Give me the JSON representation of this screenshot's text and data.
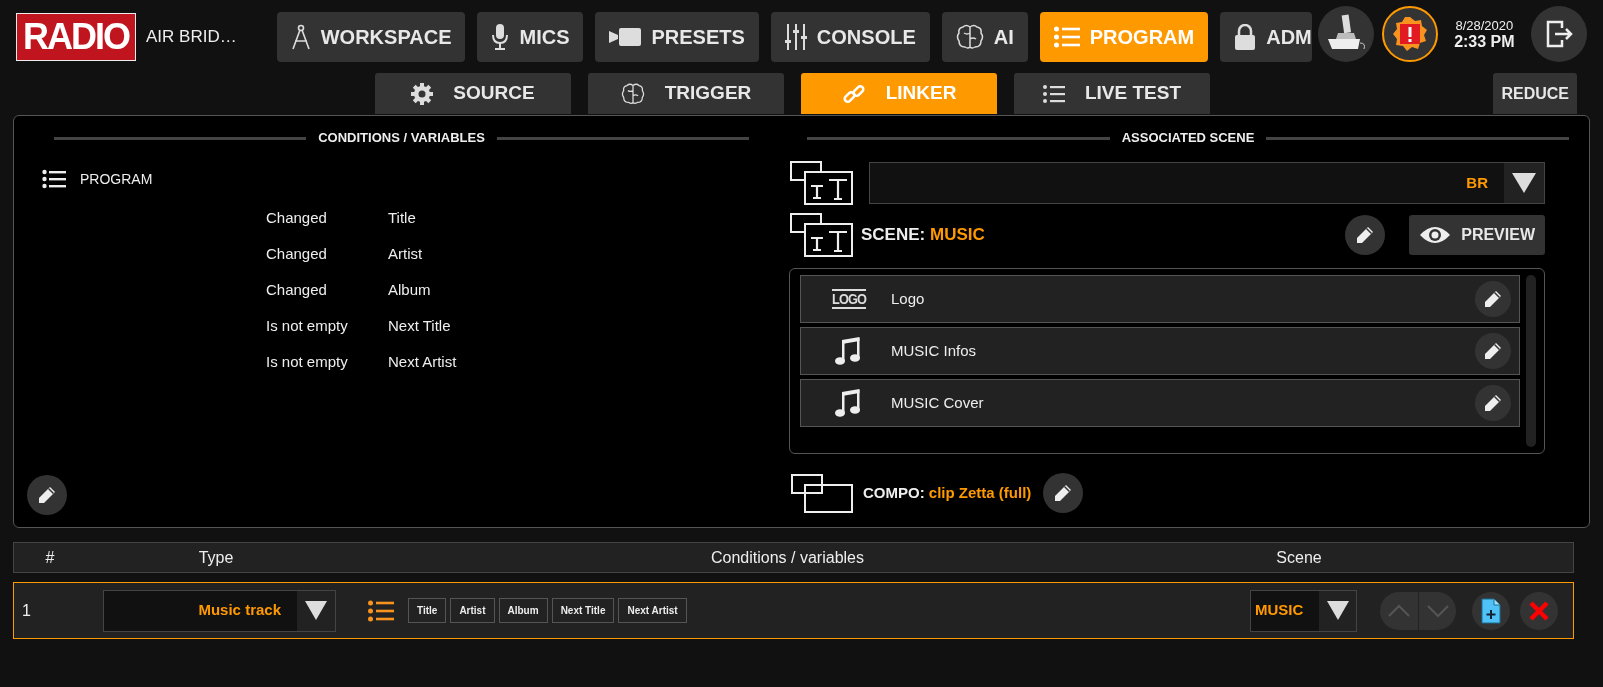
{
  "header": {
    "logo": "RADIO",
    "station": "AIR BRID…",
    "nav": [
      {
        "label": "WORKSPACE",
        "selected": false
      },
      {
        "label": "MICS",
        "selected": false
      },
      {
        "label": "PRESETS",
        "selected": false
      },
      {
        "label": "CONSOLE",
        "selected": false
      },
      {
        "label": "AI",
        "selected": false
      },
      {
        "label": "PROGRAM",
        "selected": true
      },
      {
        "label": "ADM",
        "selected": false
      }
    ],
    "date": "8/28/2020",
    "time": "2:33 PM"
  },
  "subtabs": [
    {
      "label": "SOURCE",
      "selected": false
    },
    {
      "label": "TRIGGER",
      "selected": false
    },
    {
      "label": "LINKER",
      "selected": true
    },
    {
      "label": "LIVE TEST",
      "selected": false
    }
  ],
  "reduce_button": "REDUCE",
  "conditions": {
    "title": "CONDITIONS / VARIABLES",
    "source": "PROGRAM",
    "rows": [
      {
        "condition": "Changed",
        "variable": "Title"
      },
      {
        "condition": "Changed",
        "variable": "Artist"
      },
      {
        "condition": "Changed",
        "variable": "Album"
      },
      {
        "condition": "Is not empty",
        "variable": "Next Title"
      },
      {
        "condition": "Is not empty",
        "variable": "Next Artist"
      }
    ]
  },
  "scene": {
    "title": "ASSOCIATED SCENE",
    "dropdown_value": "BR",
    "scene_label": "SCENE:",
    "scene_name": "MUSIC",
    "preview_button": "PREVIEW",
    "layers": [
      {
        "kind": "logo",
        "icon_text": "LOGO",
        "name": "Logo"
      },
      {
        "kind": "music",
        "name": "MUSIC Infos"
      },
      {
        "kind": "music",
        "name": "MUSIC Cover"
      }
    ],
    "compo_label": "COMPO:",
    "compo_name": "clip Zetta (full)"
  },
  "table": {
    "columns": [
      "#",
      "Type",
      "Conditions / variables",
      "Scene"
    ],
    "rows": [
      {
        "index": "1",
        "type": "Music track",
        "variables": [
          "Title",
          "Artist",
          "Album",
          "Next Title",
          "Next Artist"
        ],
        "scene": "MUSIC",
        "selected": true
      }
    ]
  }
}
